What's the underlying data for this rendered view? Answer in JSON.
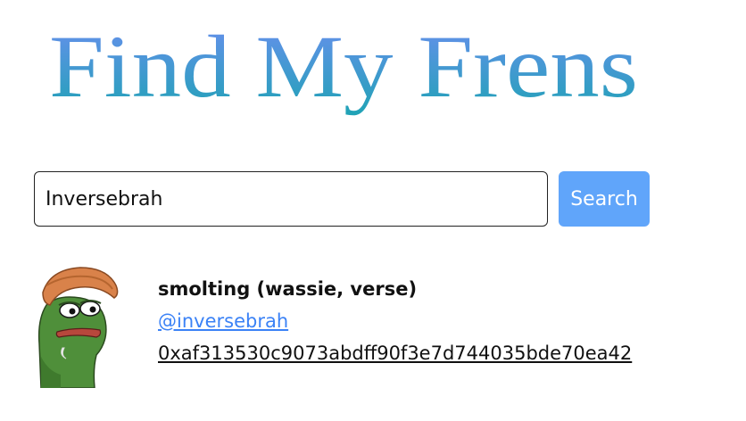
{
  "header": {
    "logo_text": "Find My Frens"
  },
  "search": {
    "value": "Inversebrah",
    "button_label": "Search"
  },
  "results": [
    {
      "avatar_icon": "pepe-frog-avatar",
      "name": "smolting (wassie, verse)",
      "handle": "@inversebrah",
      "address": "0xaf313530c9073abdff90f3e7d744035bde70ea42"
    }
  ],
  "colors": {
    "logo_gradient_top": "#6b8ef0",
    "logo_gradient_bottom": "#1fa3b5",
    "button_bg": "#60a5fa",
    "link": "#3b82f6"
  }
}
